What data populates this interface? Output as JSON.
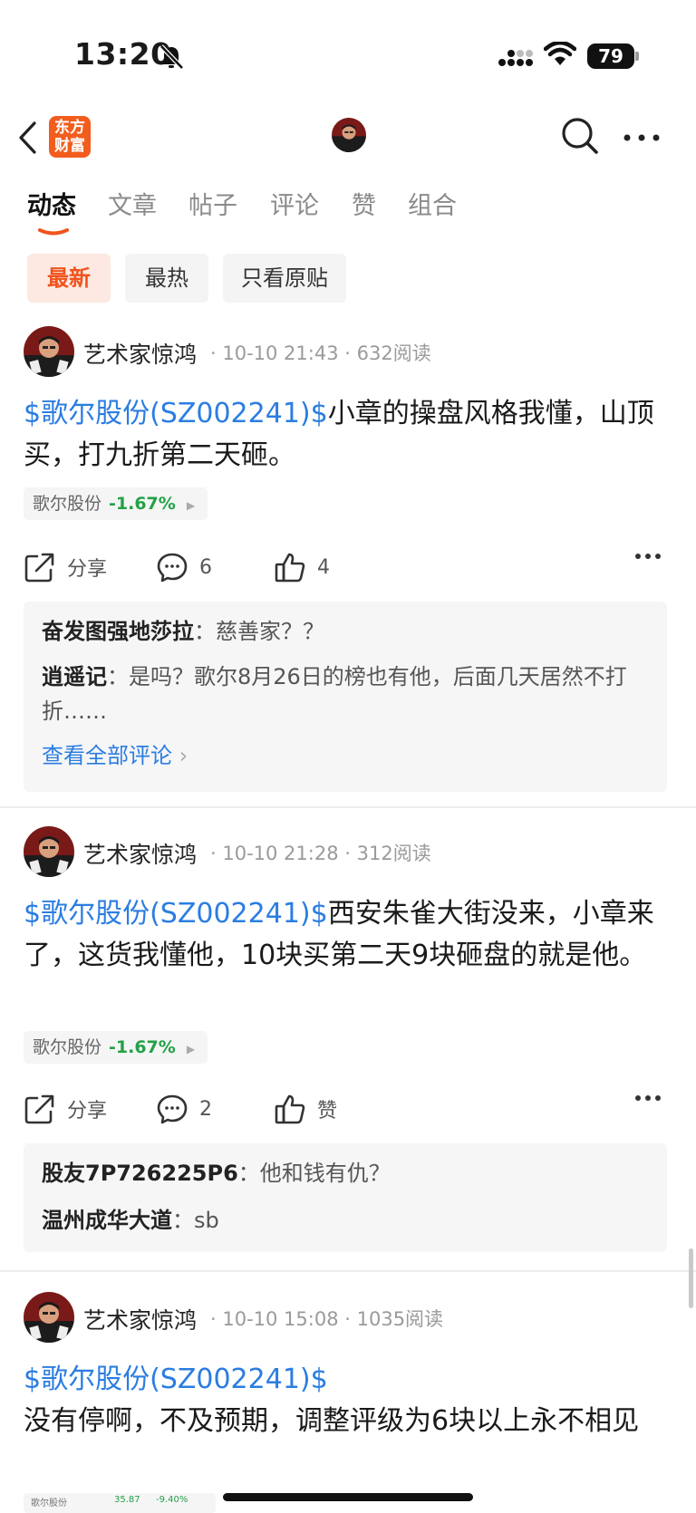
{
  "status_bar": {
    "time": "13:20",
    "battery": "79"
  },
  "header": {
    "logo_text": "东方财富"
  },
  "tabs": [
    {
      "label": "动态"
    },
    {
      "label": "文章"
    },
    {
      "label": "帖子"
    },
    {
      "label": "评论"
    },
    {
      "label": "赞"
    },
    {
      "label": "组合"
    }
  ],
  "filters": [
    {
      "label": "最新"
    },
    {
      "label": "最热"
    },
    {
      "label": "只看原贴"
    }
  ],
  "posts": [
    {
      "author": "艺术家惊鸿",
      "time": "10-10 21:43",
      "reads": "632阅读",
      "stock_link": "$歌尔股份(SZ002241)$",
      "text": "小章的操盘风格我懂，山顶买，打九折第二天砸。",
      "stock_name": "歌尔股份",
      "stock_change": "-1.67%",
      "share_label": "分享",
      "comment_count": "6",
      "like_label": "4",
      "comments": [
        {
          "name": "奋发图强地莎拉",
          "text": "慈善家？？"
        },
        {
          "name": "逍遥记",
          "text": "是吗？歌尔8月26日的榜也有他，后面几天居然不打折……"
        }
      ],
      "view_all": "查看全部评论"
    },
    {
      "author": "艺术家惊鸿",
      "time": "10-10 21:28",
      "reads": "312阅读",
      "stock_link": "$歌尔股份(SZ002241)$",
      "text": "西安朱雀大街没来，小章来了，这货我懂他，10块买第二天9块砸盘的就是他。",
      "stock_name": "歌尔股份",
      "stock_change": "-1.67%",
      "share_label": "分享",
      "comment_count": "2",
      "like_label": "赞",
      "comments": [
        {
          "name": "股友7P726225P6",
          "text": "他和钱有仇？"
        },
        {
          "name": "温州成华大道",
          "text": "sb"
        }
      ]
    },
    {
      "author": "艺术家惊鸿",
      "time": "10-10 15:08",
      "reads": "1035阅读",
      "stock_link": "$歌尔股份(SZ002241)$",
      "text": "没有停啊，不及预期，调整评级为6块以上永不相见"
    }
  ],
  "partial_card": {
    "name": "歌尔股份",
    "price": "35.87",
    "change": "-9.40%"
  },
  "colors": {
    "accent": "#f0531d",
    "link": "#2b7de1",
    "down": "#23a147"
  }
}
